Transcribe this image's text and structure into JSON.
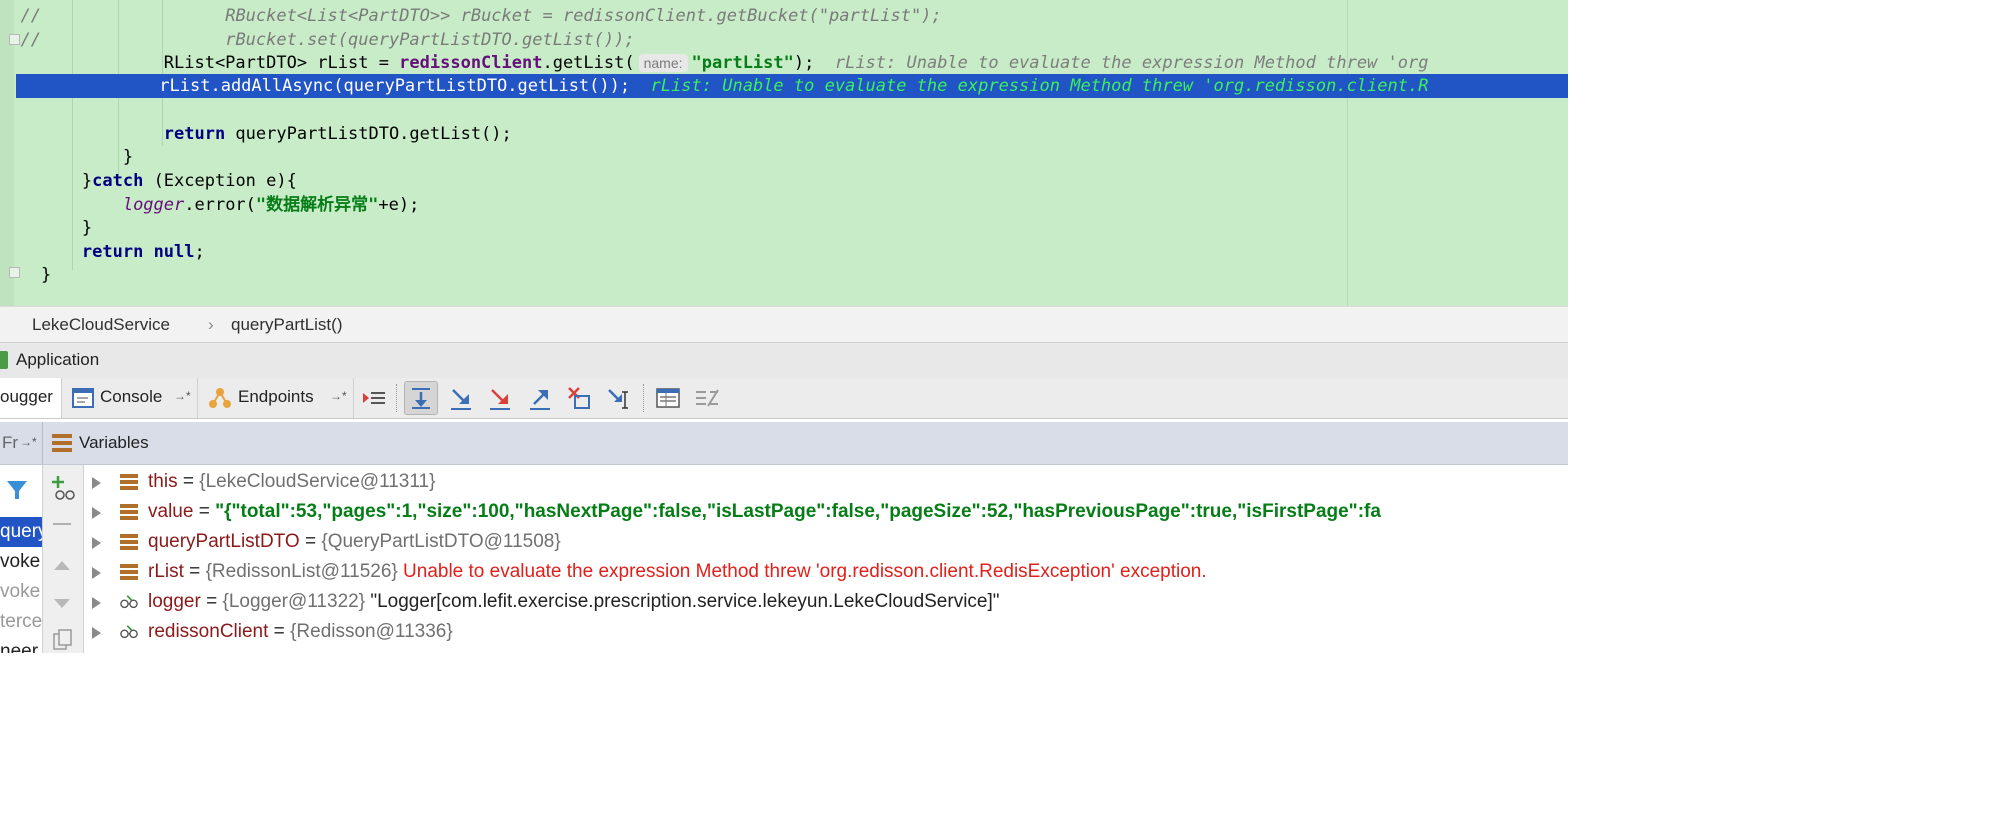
{
  "editor": {
    "line1": {
      "prefix": "//",
      "code": "RBucket<List<PartDTO>> rBucket = redissonClient.getBucket(\"partList\");"
    },
    "line2": {
      "prefix": "//",
      "code": "rBucket.set(queryPartListDTO.getList());"
    },
    "line3": {
      "decl": "RList<PartDTO> rList = ",
      "client": "redissonClient",
      "call": ".getList(",
      "hint": "name:",
      "arg": "\"partList\"",
      "end": ");",
      "inline": "rList: Unable to evaluate the expression Method threw 'org"
    },
    "line4": {
      "code": "rList.addAllAsync(queryPartListDTO.getList());",
      "inline": "rList: Unable to evaluate the expression Method threw 'org.redisson.client.R"
    },
    "line5": {
      "kw": "return",
      "rest": " queryPartListDTO.getList();"
    },
    "line6": "}",
    "line7": {
      "brace": "}",
      "kw": "catch",
      "rest": " (Exception e){"
    },
    "line8": {
      "obj": "logger",
      "call": ".error(",
      "arg": "\"数据解析异常\"",
      "rest": "+e);"
    },
    "line9": "}",
    "line10": {
      "kw1": "return",
      "kw2": "null",
      "end": ";"
    },
    "line11": "}"
  },
  "breadcrumb": {
    "class_name": "LekeCloudService",
    "separator": "›",
    "method_name": "queryPartList()"
  },
  "run_window": {
    "title": "Application"
  },
  "toolbar": {
    "tab_debugger": "ougger",
    "tab_console": "Console",
    "tab_endpoints": "Endpoints",
    "pin_glyph": "→*"
  },
  "frames_header": {
    "label": "Fr",
    "pin": "→*"
  },
  "variables_header": {
    "label": "Variables"
  },
  "frames": [
    "queryP",
    "voke",
    "voke",
    "terce",
    "neer"
  ],
  "variables": [
    {
      "name": "this",
      "eq": " = ",
      "ref": "{LekeCloudService@11311}",
      "icon": "field-icon"
    },
    {
      "name": "value",
      "eq": " = ",
      "str": "\"{\"total\":53,\"pages\":1,\"size\":100,\"hasNextPage\":false,\"isLastPage\":false,\"pageSize\":52,\"hasPreviousPage\":true,\"isFirstPage\":fa",
      "icon": "field-icon"
    },
    {
      "name": "queryPartListDTO",
      "eq": " = ",
      "ref": "{QueryPartListDTO@11508}",
      "icon": "field-icon"
    },
    {
      "name": "rList",
      "eq": " = ",
      "ref": "{RedissonList@11526}",
      "error": "Unable to evaluate the expression Method threw 'org.redisson.client.RedisException' exception.",
      "icon": "field-icon"
    },
    {
      "name": "logger",
      "eq": " = ",
      "ref": "{Logger@11322}",
      "plain": "\"Logger[com.lefit.exercise.prescription.service.lekeyun.LekeCloudService]\"",
      "icon": "watch-glasses-icon"
    },
    {
      "name": "redissonClient",
      "eq": " = ",
      "ref": "{Redisson@11336}",
      "icon": "watch-glasses-icon"
    }
  ],
  "colors": {
    "editor_bg": "#c8ecc8",
    "selection": "#2154c4",
    "string": "#067d17",
    "keyword": "#000080",
    "error": "#e0201a"
  }
}
